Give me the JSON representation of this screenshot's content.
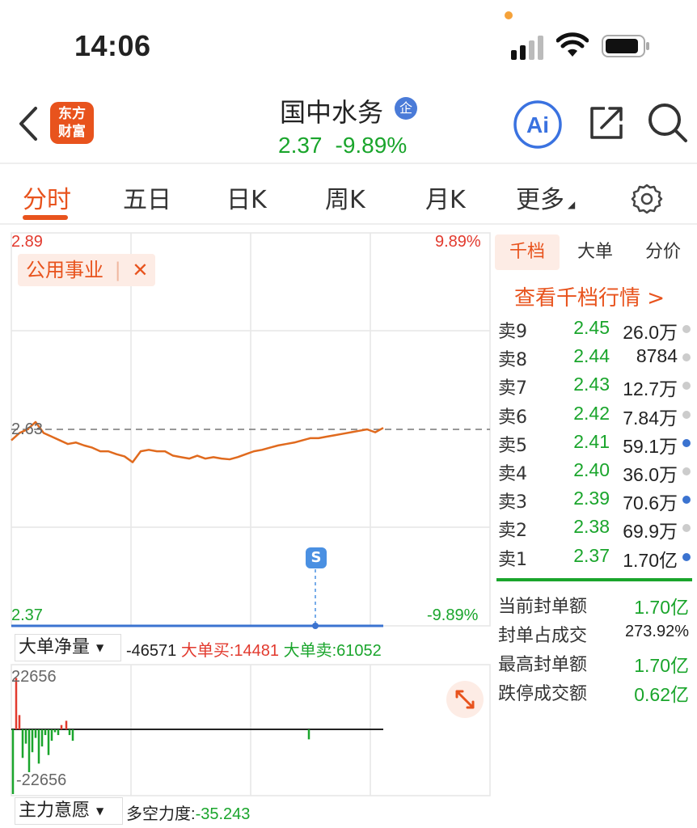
{
  "status_bar": {
    "time": "14:06"
  },
  "header": {
    "logo_text_line1": "东方",
    "logo_text_line2": "财富",
    "stock_name": "国中水务",
    "badge": "企",
    "price": "2.37",
    "change_pct": "-9.89%"
  },
  "tabs": [
    {
      "label": "分时",
      "active": true
    },
    {
      "label": "五日",
      "active": false
    },
    {
      "label": "日K",
      "active": false
    },
    {
      "label": "周K",
      "active": false
    },
    {
      "label": "月K",
      "active": false
    },
    {
      "label": "更多",
      "active": false
    }
  ],
  "chart": {
    "y_high": "2.89",
    "y_high_pct": "9.89%",
    "y_prev": "2.63",
    "y_low": "2.37",
    "y_low_pct": "-9.89%",
    "sector_tag": "公用事业",
    "sector_close": "✕",
    "marker": "S"
  },
  "chart_data": [
    {
      "type": "line",
      "ylim": [
        2.37,
        2.89
      ],
      "prev_close": 2.63,
      "x": [
        0,
        10,
        20,
        30,
        40,
        50,
        60,
        70,
        80,
        90,
        100,
        110,
        120,
        130,
        140,
        150,
        160,
        170,
        180,
        190,
        200,
        210,
        220,
        230,
        240,
        250,
        260,
        270,
        280,
        290,
        300,
        310,
        320,
        330,
        340,
        350,
        360,
        370,
        380,
        390,
        400,
        410,
        420,
        430,
        440,
        450,
        460
      ],
      "values": [
        2.615,
        2.625,
        2.63,
        2.64,
        2.625,
        2.62,
        2.615,
        2.61,
        2.612,
        2.608,
        2.605,
        2.6,
        2.6,
        2.596,
        2.593,
        2.585,
        2.6,
        2.602,
        2.6,
        2.6,
        2.594,
        2.592,
        2.59,
        2.594,
        2.59,
        2.592,
        2.59,
        2.589,
        2.592,
        2.596,
        2.6,
        2.602,
        2.605,
        2.608,
        2.61,
        2.612,
        2.615,
        2.618,
        2.618,
        2.62,
        2.622,
        2.624,
        2.626,
        2.628,
        2.63,
        2.626,
        2.632
      ]
    },
    {
      "type": "bar",
      "title": "大单净量",
      "ylim": [
        -22656,
        22656
      ],
      "x": [
        0,
        4,
        8,
        12,
        16,
        20,
        24,
        28,
        32,
        36,
        40,
        44,
        48,
        52,
        56,
        60,
        66,
        70,
        74,
        366
      ],
      "values": [
        -22656,
        18000,
        5000,
        -10000,
        -5000,
        -15000,
        -8000,
        -3000,
        -12000,
        -6000,
        -2000,
        -9000,
        -4000,
        -1000,
        -2000,
        1500,
        3000,
        -2000,
        -4000,
        -3500
      ]
    }
  ],
  "big_order": {
    "selector": "大单净量",
    "net": "-46571",
    "buy_label": "大单买:",
    "buy_value": "14481",
    "sell_label": "大单卖:",
    "sell_value": "61052",
    "axis_top": "22656",
    "axis_bottom": "-22656"
  },
  "bottom": {
    "selector": "主力意愿",
    "label": "多空力度:",
    "value": "-35.243"
  },
  "panel": {
    "tabs": [
      "千档",
      "大单",
      "分价"
    ],
    "view_all": "查看千档行情 >",
    "asks": [
      {
        "label": "卖9",
        "price": "2.45",
        "vol": "26.0万",
        "dot": "gray"
      },
      {
        "label": "卖8",
        "price": "2.44",
        "vol": "8784",
        "dot": "gray"
      },
      {
        "label": "卖7",
        "price": "2.43",
        "vol": "12.7万",
        "dot": "gray"
      },
      {
        "label": "卖6",
        "price": "2.42",
        "vol": "7.84万",
        "dot": "gray"
      },
      {
        "label": "卖5",
        "price": "2.41",
        "vol": "59.1万",
        "dot": "blue"
      },
      {
        "label": "卖4",
        "price": "2.40",
        "vol": "36.0万",
        "dot": "gray"
      },
      {
        "label": "卖3",
        "price": "2.39",
        "vol": "70.6万",
        "dot": "blue"
      },
      {
        "label": "卖2",
        "price": "2.38",
        "vol": "69.9万",
        "dot": "gray"
      },
      {
        "label": "卖1",
        "price": "2.37",
        "vol": "1.70亿",
        "dot": "blue"
      }
    ],
    "summary": [
      {
        "label": "当前封单额",
        "value": "1.70亿"
      },
      {
        "label": "封单占成交",
        "value": "273.92%"
      },
      {
        "label": "最高封单额",
        "value": "1.70亿"
      },
      {
        "label": "跌停成交额",
        "value": "0.62亿"
      }
    ]
  },
  "colors": {
    "brand": "#e8531d",
    "up": "#e23a2e",
    "down": "#1aa52c",
    "price_line": "#e06a1e"
  }
}
